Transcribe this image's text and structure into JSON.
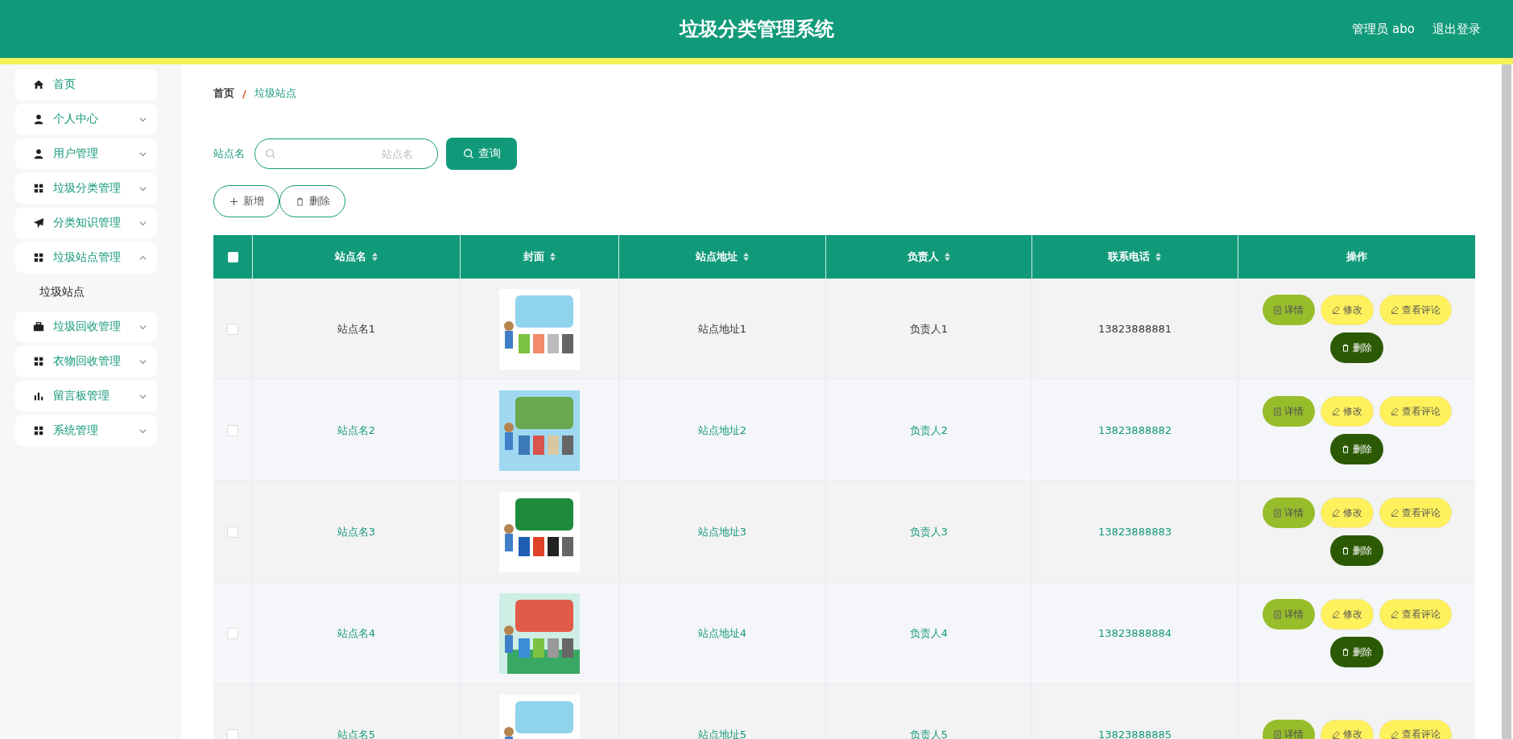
{
  "header": {
    "title": "垃圾分类管理系统",
    "user": "管理员 abo",
    "logout": "退出登录"
  },
  "sidebar": {
    "items": [
      {
        "label": "首页"
      },
      {
        "label": "个人中心",
        "expanded": false
      },
      {
        "label": "用户管理",
        "expanded": false
      },
      {
        "label": "垃圾分类管理",
        "expanded": false
      },
      {
        "label": "分类知识管理",
        "expanded": false
      },
      {
        "label": "垃圾站点管理",
        "expanded": true,
        "children": [
          {
            "label": "垃圾站点"
          }
        ]
      },
      {
        "label": "垃圾回收管理",
        "expanded": false
      },
      {
        "label": "衣物回收管理",
        "expanded": false
      },
      {
        "label": "留言板管理",
        "expanded": false
      },
      {
        "label": "系统管理",
        "expanded": false
      }
    ]
  },
  "breadcrumb": {
    "items": [
      "首页",
      "垃圾站点"
    ],
    "separator": "/"
  },
  "search": {
    "label": "站点名",
    "placeholder": "站点名",
    "button": "查询"
  },
  "toolbar": {
    "add": "新增",
    "delete": "删除"
  },
  "table": {
    "select_all_checked": false,
    "columns": [
      {
        "label": "站点名",
        "sortable": true
      },
      {
        "label": "封面",
        "sortable": true
      },
      {
        "label": "站点地址",
        "sortable": true
      },
      {
        "label": "负责人",
        "sortable": true
      },
      {
        "label": "联系电话",
        "sortable": true
      },
      {
        "label": "操作",
        "sortable": false
      }
    ],
    "rows": [
      {
        "checked": false,
        "hovered": true,
        "name": "站点名1",
        "cover": {
          "kind": "picture"
        },
        "address": "站点地址1",
        "manager": "负责人1",
        "phone": "13823888881",
        "actions": [
          {
            "kind": "detail",
            "label": "详情"
          },
          {
            "kind": "edit",
            "label": "修改"
          },
          {
            "kind": "comments",
            "label": "查看评论"
          },
          {
            "kind": "delete",
            "label": "删除"
          }
        ]
      },
      {
        "checked": false,
        "hovered": false,
        "name": "站点名2",
        "cover": {
          "kind": "picture"
        },
        "address": "站点地址2",
        "manager": "负责人2",
        "phone": "13823888882",
        "actions": [
          {
            "kind": "detail",
            "label": "详情"
          },
          {
            "kind": "edit",
            "label": "修改"
          },
          {
            "kind": "comments",
            "label": "查看评论"
          },
          {
            "kind": "delete",
            "label": "删除"
          }
        ]
      },
      {
        "checked": false,
        "hovered": false,
        "name": "站点名3",
        "cover": {
          "kind": "picture"
        },
        "address": "站点地址3",
        "manager": "负责人3",
        "phone": "13823888883",
        "actions": [
          {
            "kind": "detail",
            "label": "详情"
          },
          {
            "kind": "edit",
            "label": "修改"
          },
          {
            "kind": "comments",
            "label": "查看评论"
          },
          {
            "kind": "delete",
            "label": "删除"
          }
        ]
      },
      {
        "checked": false,
        "hovered": false,
        "name": "站点名4",
        "cover": {
          "kind": "picture"
        },
        "address": "站点地址4",
        "manager": "负责人4",
        "phone": "13823888884",
        "actions": [
          {
            "kind": "detail",
            "label": "详情"
          },
          {
            "kind": "edit",
            "label": "修改"
          },
          {
            "kind": "comments",
            "label": "查看评论"
          },
          {
            "kind": "delete",
            "label": "删除"
          }
        ]
      },
      {
        "checked": false,
        "hovered": false,
        "name": "站点名5",
        "cover": {
          "kind": "picture"
        },
        "address": "站点地址5",
        "manager": "负责人5",
        "phone": "13823888885",
        "actions": [
          {
            "kind": "detail",
            "label": "详情"
          },
          {
            "kind": "edit",
            "label": "修改"
          },
          {
            "kind": "comments",
            "label": "查看评论"
          }
        ]
      }
    ]
  }
}
